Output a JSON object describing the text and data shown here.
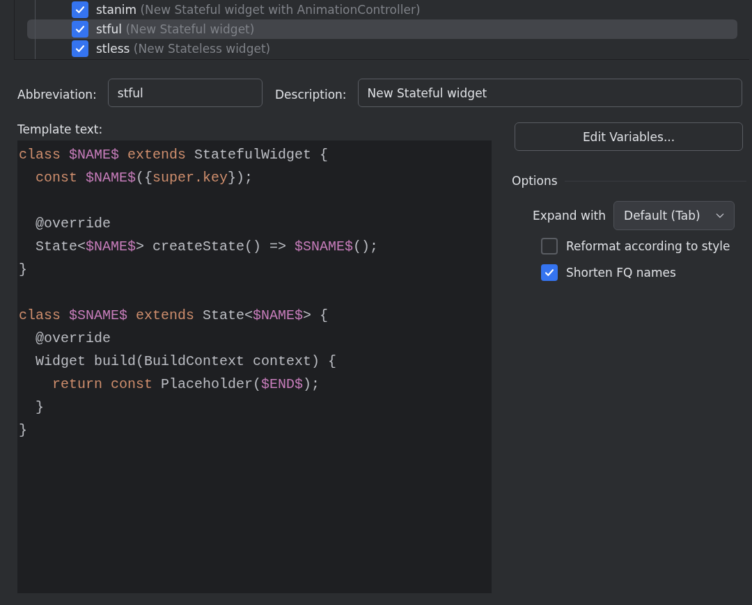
{
  "templates": [
    {
      "abbreviation": "stanim",
      "description": "(New Stateful widget with AnimationController)",
      "checked": true,
      "selected": false
    },
    {
      "abbreviation": "stful",
      "description": "(New Stateful widget)",
      "checked": true,
      "selected": true
    },
    {
      "abbreviation": "stless",
      "description": "(New Stateless widget)",
      "checked": true,
      "selected": false
    }
  ],
  "abbreviation": {
    "label": "Abbreviation:",
    "value": "stful"
  },
  "description": {
    "label": "Description:",
    "value": "New Stateful widget"
  },
  "template_text": {
    "label": "Template text:",
    "lines": [
      {
        "kind": "code",
        "tokens": [
          {
            "text": "class ",
            "kind": "keyword"
          },
          {
            "text": "$NAME$",
            "kind": "variable"
          },
          {
            "text": " extends ",
            "kind": "keyword"
          },
          {
            "text": "StatefulWidget {",
            "kind": "plain"
          }
        ]
      },
      {
        "kind": "code",
        "tokens": [
          {
            "text": "  const ",
            "kind": "keyword"
          },
          {
            "text": "$NAME$",
            "kind": "variable"
          },
          {
            "text": "({",
            "kind": "plain"
          },
          {
            "text": "super.key",
            "kind": "keyword"
          },
          {
            "text": "});",
            "kind": "plain"
          }
        ]
      },
      {
        "kind": "blank"
      },
      {
        "kind": "code",
        "tokens": [
          {
            "text": "  @override",
            "kind": "plain"
          }
        ]
      },
      {
        "kind": "code",
        "tokens": [
          {
            "text": "  State<",
            "kind": "plain"
          },
          {
            "text": "$NAME$",
            "kind": "variable"
          },
          {
            "text": "> createState() => ",
            "kind": "plain"
          },
          {
            "text": "$SNAME$",
            "kind": "variable"
          },
          {
            "text": "();",
            "kind": "plain"
          }
        ]
      },
      {
        "kind": "code",
        "tokens": [
          {
            "text": "}",
            "kind": "plain"
          }
        ]
      },
      {
        "kind": "blank"
      },
      {
        "kind": "code",
        "tokens": [
          {
            "text": "class ",
            "kind": "keyword"
          },
          {
            "text": "$SNAME$",
            "kind": "variable"
          },
          {
            "text": " extends ",
            "kind": "keyword"
          },
          {
            "text": "State<",
            "kind": "plain"
          },
          {
            "text": "$NAME$",
            "kind": "variable"
          },
          {
            "text": "> {",
            "kind": "plain"
          }
        ]
      },
      {
        "kind": "code",
        "tokens": [
          {
            "text": "  @override",
            "kind": "plain"
          }
        ]
      },
      {
        "kind": "code",
        "tokens": [
          {
            "text": "  Widget build(BuildContext context) {",
            "kind": "plain"
          }
        ]
      },
      {
        "kind": "code",
        "tokens": [
          {
            "text": "    return const ",
            "kind": "keyword"
          },
          {
            "text": "Placeholder(",
            "kind": "plain"
          },
          {
            "text": "$END$",
            "kind": "variable"
          },
          {
            "text": ");",
            "kind": "plain"
          }
        ]
      },
      {
        "kind": "code",
        "tokens": [
          {
            "text": "  }",
            "kind": "plain"
          }
        ]
      },
      {
        "kind": "code",
        "tokens": [
          {
            "text": "}",
            "kind": "plain"
          }
        ]
      }
    ]
  },
  "edit_variables_button": {
    "label": "Edit Variables..."
  },
  "options": {
    "title": "Options",
    "expand_with": {
      "label": "Expand with",
      "value": "Default (Tab)"
    },
    "checkboxes": [
      {
        "label": "Reformat according to style",
        "checked": false
      },
      {
        "label": "Shorten FQ names",
        "checked": true
      }
    ]
  }
}
